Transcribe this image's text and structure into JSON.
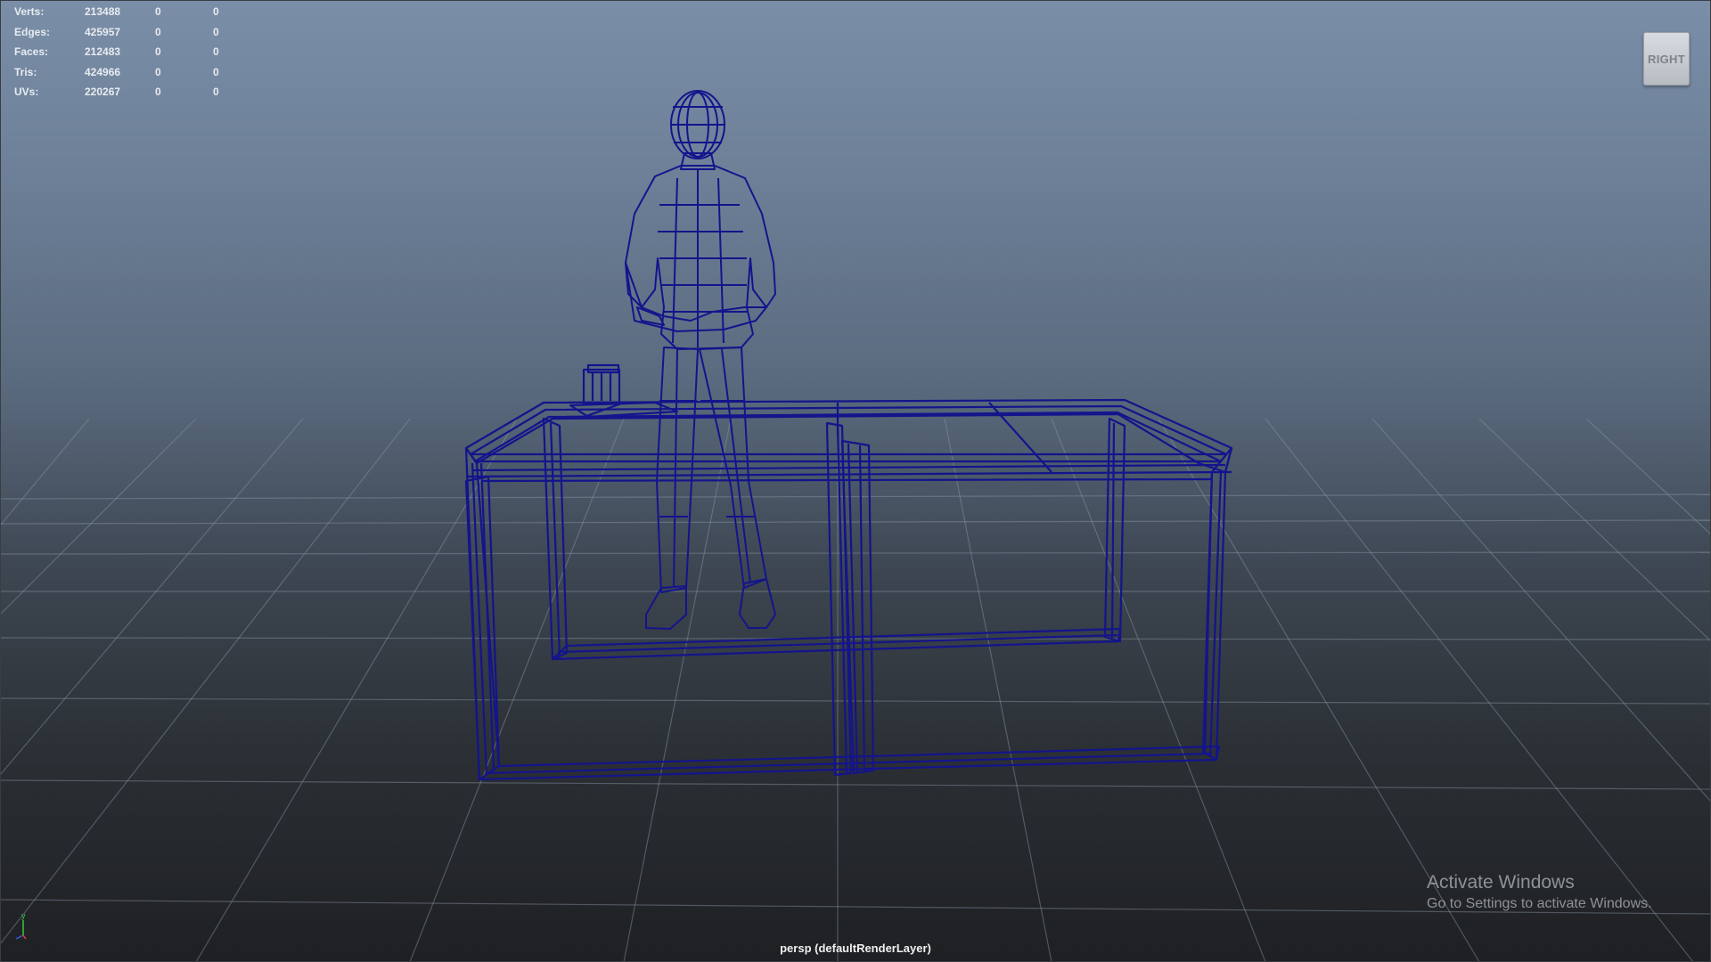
{
  "hud": {
    "rows": [
      {
        "label": "Verts:",
        "value": "213488",
        "selected": "0",
        "component": "0"
      },
      {
        "label": "Edges:",
        "value": "425957",
        "selected": "0",
        "component": "0"
      },
      {
        "label": "Faces:",
        "value": "212483",
        "selected": "0",
        "component": "0"
      },
      {
        "label": "Tris:",
        "value": "424966",
        "selected": "0",
        "component": "0"
      },
      {
        "label": "UVs:",
        "value": "220267",
        "selected": "0",
        "component": "0"
      }
    ]
  },
  "viewcube": {
    "face_label": "RIGHT"
  },
  "camera_label": "persp (defaultRenderLayer)",
  "axis": {
    "y_label": "y"
  },
  "watermark": {
    "title": "Activate Windows",
    "subtitle": "Go to Settings to activate Windows."
  },
  "colors": {
    "wireframe": "#14148c",
    "grid": "#8a96a6"
  }
}
